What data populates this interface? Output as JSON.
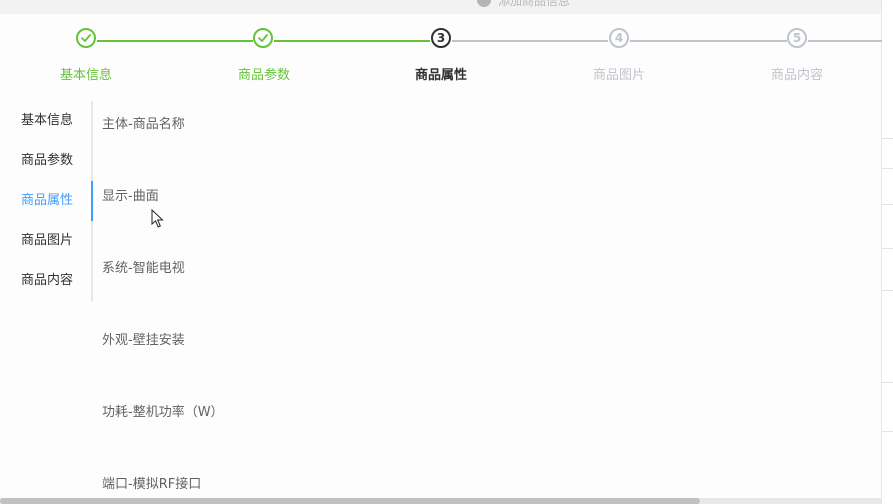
{
  "topbar": {
    "info_text": "添加商品信息"
  },
  "steps": [
    {
      "title": "基本信息",
      "status": "done",
      "index": "1"
    },
    {
      "title": "商品参数",
      "status": "done",
      "index": "2"
    },
    {
      "title": "商品属性",
      "status": "current",
      "index": "3"
    },
    {
      "title": "商品图片",
      "status": "todo",
      "index": "4"
    },
    {
      "title": "商品内容",
      "status": "todo",
      "index": "5"
    }
  ],
  "tabs": [
    {
      "label": "基本信息"
    },
    {
      "label": "商品参数"
    },
    {
      "label": "商品属性",
      "active": true
    },
    {
      "label": "商品图片"
    },
    {
      "label": "商品内容"
    }
  ],
  "attributes": [
    {
      "label": "主体-商品名称"
    },
    {
      "label": "显示-曲面"
    },
    {
      "label": "系统-智能电视"
    },
    {
      "label": "外观-壁挂安装"
    },
    {
      "label": "功耗-整机功率（W）"
    },
    {
      "label": "端口-模拟RF接口"
    }
  ],
  "colors": {
    "done": "#67c23a",
    "current": "#303133",
    "todo": "#c0c4cc",
    "active_tab": "#409eff"
  }
}
